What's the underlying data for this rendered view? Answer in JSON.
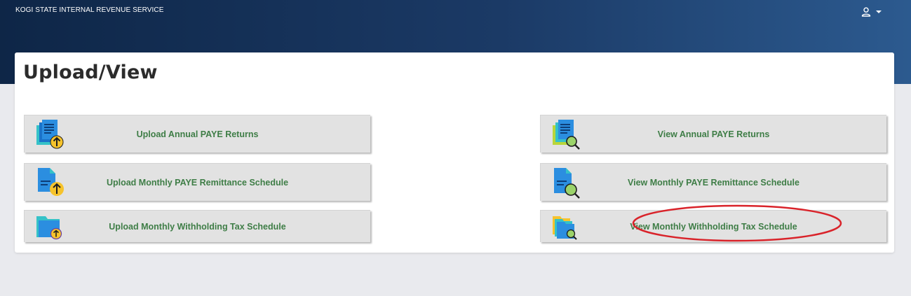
{
  "header": {
    "brand": "KOGI STATE INTERNAL REVENUE SERVICE",
    "user_icon": "user-icon",
    "caret_icon": "caret-down-icon"
  },
  "page": {
    "title": "Upload/View"
  },
  "tiles": {
    "upload_annual": {
      "label": "Upload Annual PAYE Returns",
      "icon": "upload-document-icon"
    },
    "upload_monthly_paye": {
      "label": "Upload Monthly PAYE Remittance Schedule",
      "icon": "upload-document-icon"
    },
    "upload_monthly_wht": {
      "label": "Upload Monthly Withholding Tax Schedule",
      "icon": "upload-folder-icon"
    },
    "view_annual": {
      "label": "View Annual PAYE Returns",
      "icon": "view-documents-icon"
    },
    "view_monthly_paye": {
      "label": "View Monthly PAYE Remittance Schedule",
      "icon": "view-document-icon"
    },
    "view_monthly_wht": {
      "label": "View Monthly Withholding Tax Schedule",
      "icon": "view-folders-icon"
    }
  },
  "colors": {
    "header_dark": "#0e2647",
    "header_light": "#2c5a8f",
    "label_green": "#3e7d46",
    "highlight_red": "#d9232a",
    "tile_bg": "#e2e2e2"
  }
}
